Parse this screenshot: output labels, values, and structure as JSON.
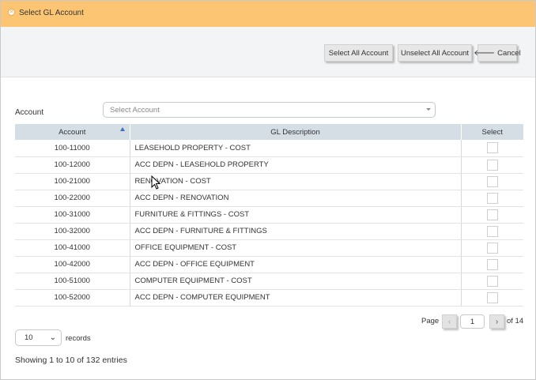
{
  "dialog": {
    "title": "Select GL Account",
    "title_icon": "close-circle-icon"
  },
  "toolbar": {
    "select_all_label": "Select All Account",
    "unselect_all_label": "Unselect All Account",
    "cancel_icon": "arrow-left-icon",
    "cancel_label": "Cancel"
  },
  "filter": {
    "label": "Account",
    "placeholder": "Select Account"
  },
  "table": {
    "headers": [
      "Account",
      "GL Description",
      "Select"
    ],
    "rows": [
      {
        "account": "100-11000",
        "description": "LEASEHOLD PROPERTY - COST",
        "selected": false
      },
      {
        "account": "100-12000",
        "description": "ACC DEPN - LEASEHOLD PROPERTY",
        "selected": false
      },
      {
        "account": "100-21000",
        "description": "RENOVATION - COST",
        "selected": false
      },
      {
        "account": "100-22000",
        "description": "ACC DEPN - RENOVATION",
        "selected": false
      },
      {
        "account": "100-31000",
        "description": "FURNITURE & FITTINGS - COST",
        "selected": false
      },
      {
        "account": "100-32000",
        "description": "ACC DEPN - FURNITURE & FITTINGS",
        "selected": false
      },
      {
        "account": "100-41000",
        "description": "OFFICE EQUIPMENT - COST",
        "selected": false
      },
      {
        "account": "100-42000",
        "description": "ACC DEPN - OFFICE EQUIPMENT",
        "selected": false
      },
      {
        "account": "100-51000",
        "description": "COMPUTER EQUIPMENT - COST",
        "selected": false
      },
      {
        "account": "100-52000",
        "description": "ACC DEPN - COMPUTER EQUIPMENT",
        "selected": false
      }
    ]
  },
  "pagination": {
    "page_label": "Page",
    "prev": "‹",
    "current_page": "1",
    "next": "›",
    "of_label": "of 14"
  },
  "records": {
    "value": "10",
    "label": "records"
  },
  "footer": {
    "showing": "Showing 1 to 10 of 132 entries"
  },
  "colors": {
    "titlebar": "#fcc574",
    "header": "#d5dde5",
    "sort_arrow": "#3a71c1"
  }
}
